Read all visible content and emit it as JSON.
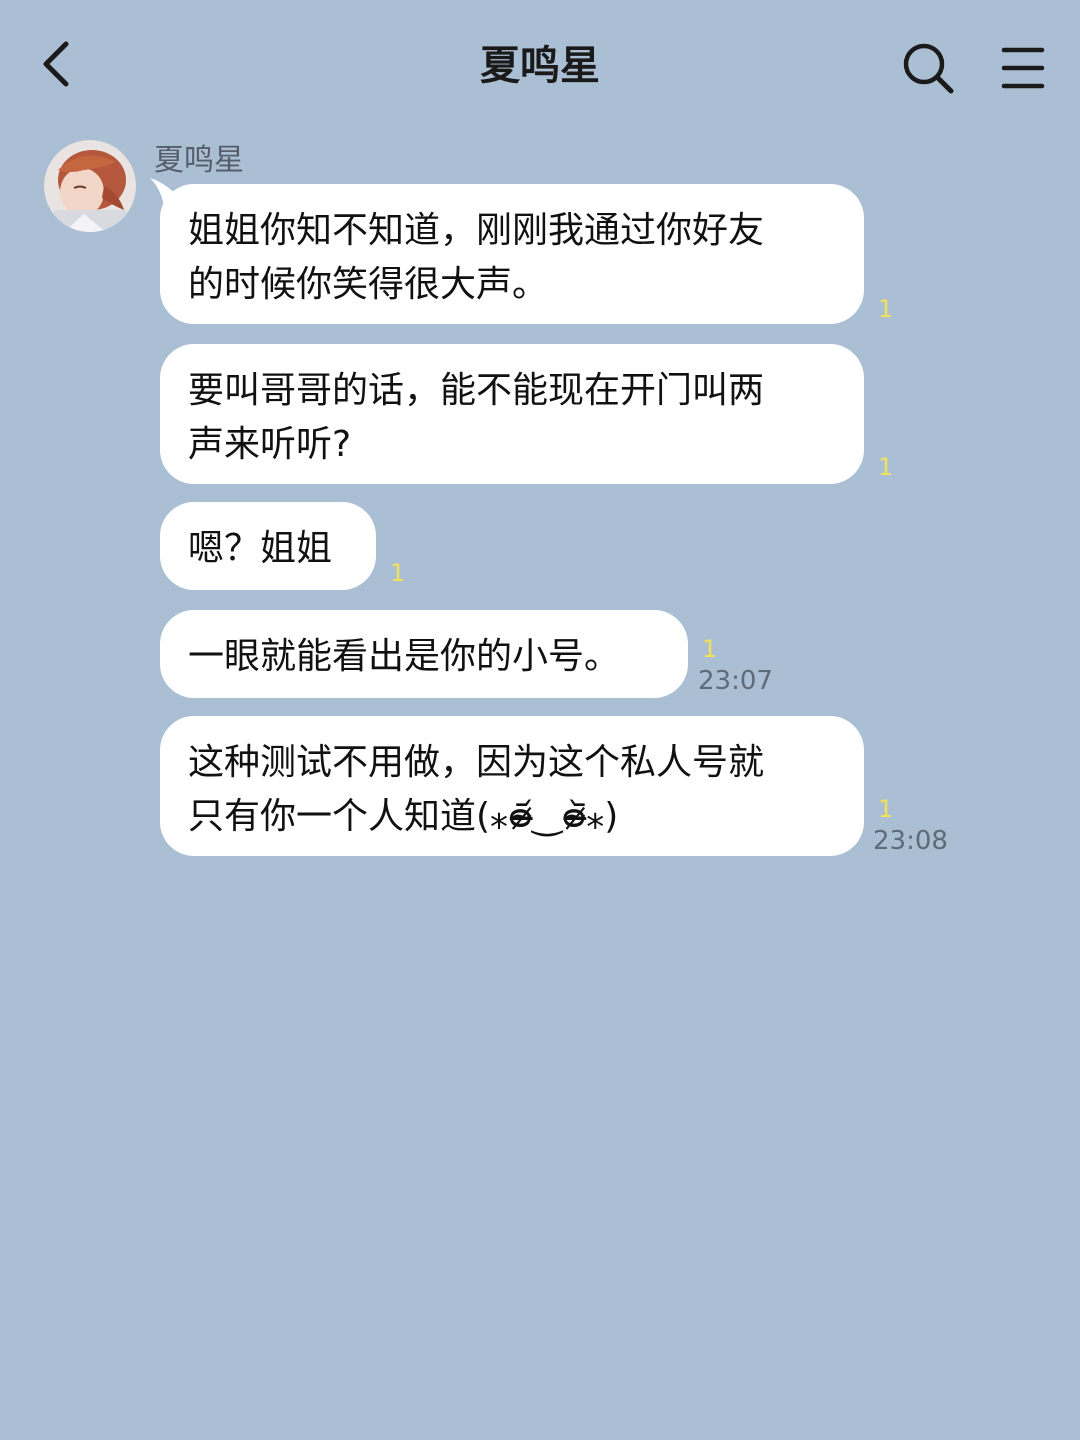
{
  "theme": {
    "background": "#abbfd4",
    "bubble": "#ffffff",
    "unread_color": "#f0e05a"
  },
  "header": {
    "title": "夏鸣星",
    "back_icon": "chevron-left-icon",
    "search_icon": "search-icon",
    "menu_icon": "menu-icon"
  },
  "chat": {
    "sender_name": "夏鸣星",
    "messages": [
      {
        "text": "姐姐你知不知道，刚刚我通过你好友\n的时候你笑得很大声。",
        "unread": "1",
        "time": ""
      },
      {
        "text": "要叫哥哥的话，能不能现在开门叫两\n声来听听?",
        "unread": "1",
        "time": ""
      },
      {
        "text": "嗯？姐姐",
        "unread": "1",
        "time": ""
      },
      {
        "text": "一眼就能看出是你的小号。",
        "unread": "1",
        "time": "23:07"
      },
      {
        "text": "这种测试不用做，因为这个私人号就\n只有你一个人知道(⁎ᴑ̴̶̷᷄‿ᴑ̴̶̷᷅⁎)",
        "unread": "1",
        "time": "23:08"
      }
    ]
  }
}
